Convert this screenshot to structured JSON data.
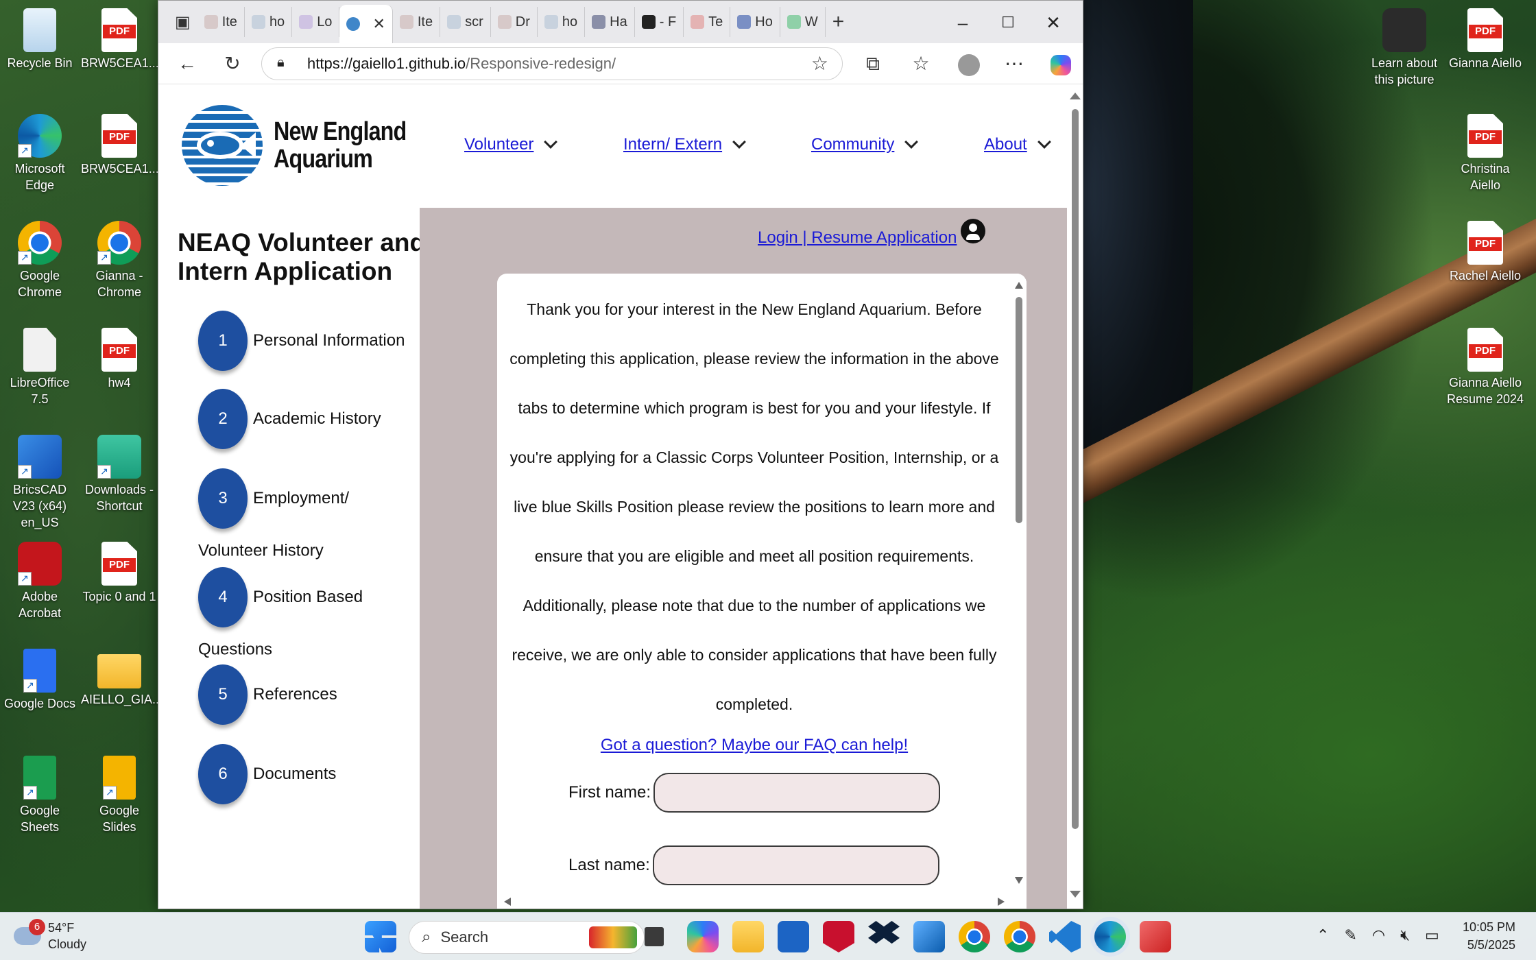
{
  "desktop": {
    "icons_left": [
      {
        "label": "Recycle Bin",
        "icon": "recycle-bin-icon"
      },
      {
        "label": "BRW5CEA1...",
        "icon": "pdf-file-icon"
      },
      {
        "label": "Microsoft Edge",
        "icon": "edge-icon"
      },
      {
        "label": "BRW5CEA1...",
        "icon": "pdf-file-icon"
      },
      {
        "label": "Google Chrome",
        "icon": "chrome-icon"
      },
      {
        "label": "Gianna - Chrome",
        "icon": "chrome-profile-icon"
      },
      {
        "label": "LibreOffice 7.5",
        "icon": "libreoffice-icon"
      },
      {
        "label": "hw4",
        "icon": "pdf-file-icon"
      },
      {
        "label": "BricsCAD V23 (x64) en_US",
        "icon": "bricscad-icon"
      },
      {
        "label": "Downloads - Shortcut",
        "icon": "downloads-folder-icon"
      },
      {
        "label": "Adobe Acrobat",
        "icon": "acrobat-icon"
      },
      {
        "label": "Topic 0 and 1",
        "icon": "pdf-file-icon"
      },
      {
        "label": "Google Docs",
        "icon": "google-docs-icon"
      },
      {
        "label": "AIELLO_GIA...",
        "icon": "folder-icon"
      },
      {
        "label": "Google Sheets",
        "icon": "google-sheets-icon"
      },
      {
        "label": "Google Slides",
        "icon": "google-slides-icon"
      }
    ],
    "icons_right": [
      {
        "label": "Learn about this picture",
        "icon": "learn-picture-icon"
      },
      {
        "label": "Gianna Aiello",
        "icon": "pdf-file-icon"
      },
      {
        "label": "Christina Aiello",
        "icon": "pdf-file-icon"
      },
      {
        "label": "Rachel Aiello",
        "icon": "pdf-file-icon"
      },
      {
        "label": "Gianna Aiello Resume 2024",
        "icon": "pdf-file-icon"
      }
    ]
  },
  "browser": {
    "tabs": [
      "Ite",
      "ho",
      "Lo",
      "",
      "Ite",
      "scr",
      "Dr",
      "ho",
      "Ha",
      "- F",
      "Te",
      "Ho",
      "W"
    ],
    "url_host": "https://gaiello1.github.io",
    "url_path": "/Responsive-redesign/"
  },
  "site": {
    "logo_line1": "New England",
    "logo_line2": "Aquarium",
    "nav": [
      "Volunteer",
      "Intern/ Extern",
      "Community",
      "About"
    ],
    "title": "NEAQ Volunteer and Intern Application",
    "steps": [
      {
        "num": "1",
        "label": "Personal Information"
      },
      {
        "num": "2",
        "label": "Academic History"
      },
      {
        "num": "3",
        "label": "Employment/ Volunteer History"
      },
      {
        "num": "4",
        "label": "Position Based Questions"
      },
      {
        "num": "5",
        "label": "References"
      },
      {
        "num": "6",
        "label": "Documents"
      }
    ],
    "login_link": "Login | Resume Application",
    "intro": "Thank you for your interest in the New England Aquarium. Before completing this application, please review the information in the above tabs to determine which program is best for you and your lifestyle. If you're applying for a Classic Corps Volunteer Position, Internship, or a live blue Skills Position please review the positions to learn more and ensure that you are eligible and meet all position requirements. Additionally, please note that due to the number of applications we receive, we are only able to consider applications that have been fully completed.",
    "faq_link": "Got a question? Maybe our FAQ can help!",
    "first_name_label": "First name:",
    "last_name_label": "Last name:",
    "first_name_value": "",
    "last_name_value": ""
  },
  "taskbar": {
    "weather_temp": "54°F",
    "weather_desc": "Cloudy",
    "weather_badge": "6",
    "search_placeholder": "Search",
    "time": "10:05 PM",
    "date": "5/5/2025"
  }
}
